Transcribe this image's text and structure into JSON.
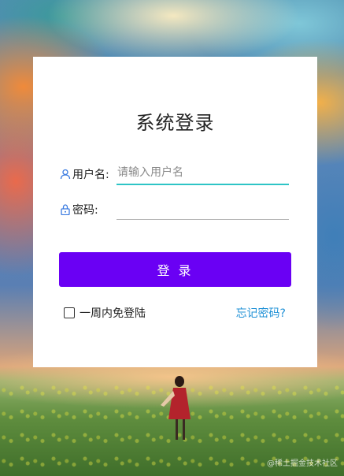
{
  "form": {
    "title": "系统登录",
    "username_label": "用户名:",
    "username_placeholder": "请输入用户名",
    "username_value": "",
    "password_label": "密码:",
    "password_value": "",
    "login_label": "登 录",
    "remember_label": "一周内免登陆",
    "forgot_label": "忘记密码?"
  },
  "watermark": "@稀土掘金技术社区",
  "icons": {
    "username": "user-icon",
    "password": "lock-icon"
  },
  "colors": {
    "primary_button": "#6a00f4",
    "active_underline": "#2ec4c6",
    "link": "#1e90d6"
  }
}
